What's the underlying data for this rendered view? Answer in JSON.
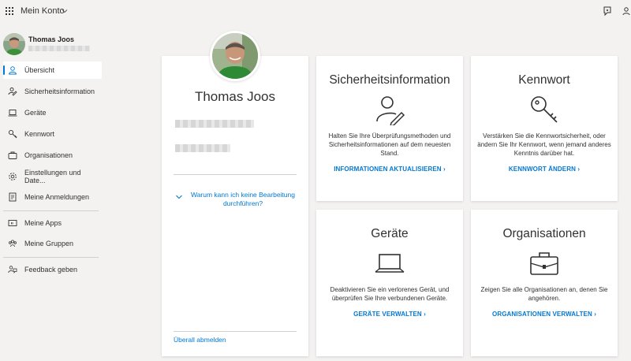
{
  "header": {
    "app_title": "Mein Konto"
  },
  "user": {
    "name": "Thomas Joos"
  },
  "sidebar": {
    "items": [
      {
        "label": "Übersicht",
        "icon": "person-icon"
      },
      {
        "label": "Sicherheitsinformation",
        "icon": "security-info-icon"
      },
      {
        "label": "Geräte",
        "icon": "laptop-icon"
      },
      {
        "label": "Kennwort",
        "icon": "key-icon"
      },
      {
        "label": "Organisationen",
        "icon": "briefcase-icon"
      },
      {
        "label": "Einstellungen und Date...",
        "icon": "gear-icon"
      },
      {
        "label": "Meine Anmeldungen",
        "icon": "signins-icon"
      },
      {
        "label": "Meine Apps",
        "icon": "apps-icon"
      },
      {
        "label": "Meine Gruppen",
        "icon": "groups-icon"
      },
      {
        "label": "Feedback geben",
        "icon": "feedback-icon"
      }
    ]
  },
  "profile": {
    "name": "Thomas Joos",
    "why_link": "Warum kann ich keine Bearbeitung durchführen?",
    "signout": "Überall abmelden"
  },
  "tiles": {
    "security": {
      "title": "Sicherheitsinformation",
      "description": "Halten Sie Ihre Überprüfungsmethoden und Sicherheitsinformationen auf dem neuesten Stand.",
      "link": "INFORMATIONEN AKTUALISIEREN",
      "icon": "person-edit-icon"
    },
    "password": {
      "title": "Kennwort",
      "description": "Verstärken Sie die Kennwortsicherheit, oder ändern Sie Ihr Kennwort, wenn jemand anderes Kenntnis darüber hat.",
      "link": "KENNWORT ÄNDERN",
      "icon": "key-icon"
    },
    "devices": {
      "title": "Geräte",
      "description": "Deaktivieren Sie ein verlorenes Gerät, und überprüfen Sie Ihre verbundenen Geräte.",
      "link": "GERÄTE VERWALTEN",
      "icon": "laptop-icon"
    },
    "organizations": {
      "title": "Organisationen",
      "description": "Zeigen Sie alle Organisationen an, denen Sie angehören.",
      "link": "ORGANISATIONEN VERWALTEN",
      "icon": "briefcase-icon"
    }
  },
  "colors": {
    "accent": "#0078d4",
    "background": "#f3f2f1",
    "text": "#323130"
  }
}
